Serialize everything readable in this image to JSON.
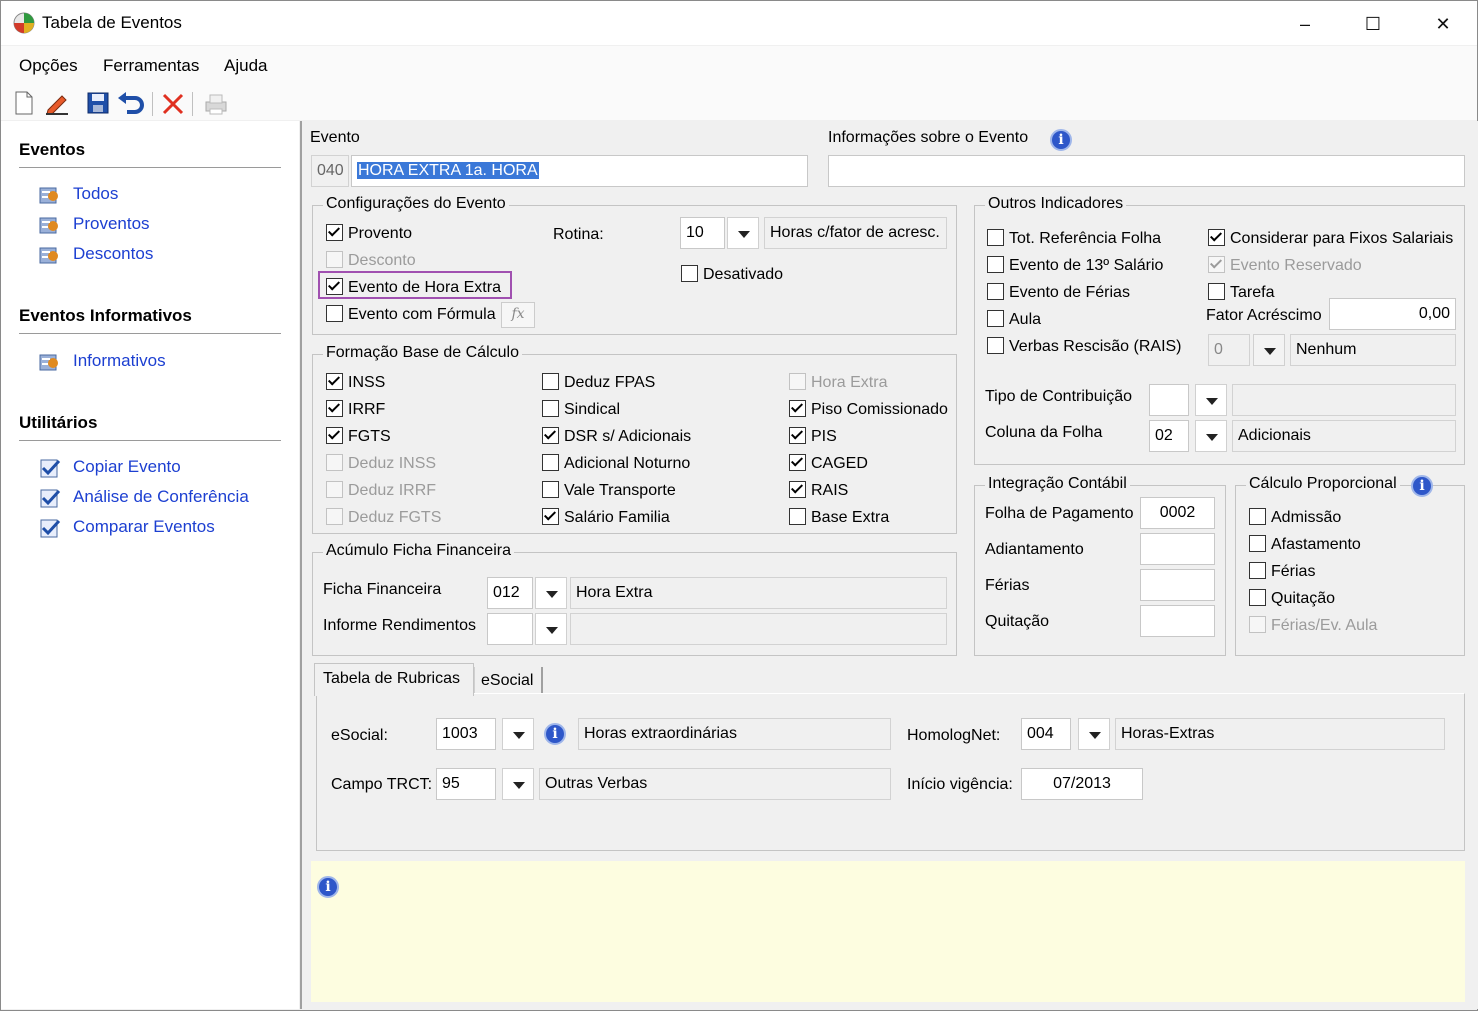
{
  "window": {
    "title": "Tabela de Eventos",
    "minimize": "–",
    "maximize": "☐",
    "close": "✕"
  },
  "menu": [
    "Opções",
    "Ferramentas",
    "Ajuda"
  ],
  "sidebar": {
    "eventos_title": "Eventos",
    "eventos_items": [
      "Todos",
      "Proventos",
      "Descontos"
    ],
    "informativos_title": "Eventos Informativos",
    "informativos_items": [
      "Informativos"
    ],
    "utilitarios_title": "Utilitários",
    "utilitarios_items": [
      "Copiar Evento",
      "Análise de Conferência",
      "Comparar Eventos"
    ]
  },
  "evento": {
    "label": "Evento",
    "code": "040",
    "name": "HORA EXTRA 1a. HORA"
  },
  "info_evento": {
    "label": "Informações sobre o Evento",
    "value": ""
  },
  "config": {
    "title": "Configurações do Evento",
    "provento": "Provento",
    "desconto": "Desconto",
    "hora_extra": "Evento de Hora Extra",
    "formula": "Evento com Fórmula",
    "rotina_label": "Rotina:",
    "rotina_code": "10",
    "rotina_desc": "Horas c/fator de acresc.",
    "desativado": "Desativado"
  },
  "base": {
    "title": "Formação Base de Cálculo",
    "col1": [
      "INSS",
      "IRRF",
      "FGTS",
      "Deduz INSS",
      "Deduz IRRF",
      "Deduz FGTS"
    ],
    "col2": [
      "Deduz FPAS",
      "Sindical",
      "DSR s/ Adicionais",
      "Adicional Noturno",
      "Vale Transporte",
      "Salário Familia"
    ],
    "col3": [
      "Hora Extra",
      "Piso Comissionado",
      "PIS",
      "CAGED",
      "RAIS",
      "Base Extra"
    ]
  },
  "acumulo": {
    "title": "Acúmulo Ficha Financeira",
    "ficha_label": "Ficha Financeira",
    "ficha_code": "012",
    "ficha_desc": "Hora Extra",
    "informe_label": "Informe Rendimentos",
    "informe_code": "",
    "informe_desc": ""
  },
  "outros": {
    "title": "Outros Indicadores",
    "left": [
      "Tot. Referência Folha",
      "Evento de 13º Salário",
      "Evento de Férias",
      "Aula",
      "Verbas Rescisão (RAIS)"
    ],
    "considerar": "Considerar para Fixos Salariais",
    "reservado": "Evento Reservado",
    "tarefa": "Tarefa",
    "fator_label": "Fator Acréscimo",
    "fator_value": "0,00",
    "rescisao_code": "0",
    "rescisao_desc": "Nenhum",
    "tipo_label": "Tipo de Contribuição",
    "tipo_code": "",
    "tipo_desc": "",
    "coluna_label": "Coluna da Folha",
    "coluna_code": "02",
    "coluna_desc": "Adicionais"
  },
  "integracao": {
    "title": "Integração Contábil",
    "folha_label": "Folha de Pagamento",
    "folha_value": "0002",
    "adiant_label": "Adiantamento",
    "ferias_label": "Férias",
    "quit_label": "Quitação"
  },
  "proporcional": {
    "title": "Cálculo Proporcional",
    "items": [
      "Admissão",
      "Afastamento",
      "Férias",
      "Quitação",
      "Férias/Ev. Aula"
    ]
  },
  "tabs": [
    "Tabela de Rubricas",
    "eSocial"
  ],
  "rubricas": {
    "esocial_label": "eSocial:",
    "esocial_code": "1003",
    "esocial_desc": "Horas extraordinárias",
    "trct_label": "Campo TRCT:",
    "trct_code": "95",
    "trct_desc": "Outras Verbas",
    "homolog_label": "HomologNet:",
    "homolog_code": "004",
    "homolog_desc": "Horas-Extras",
    "inicio_label": "Início vigência:",
    "inicio_value": "07/2013"
  },
  "colors": {
    "link": "#1c3fd1",
    "highlight": "#a050b0",
    "selection": "#3a78d8",
    "info_panel": "#fdfde0"
  }
}
